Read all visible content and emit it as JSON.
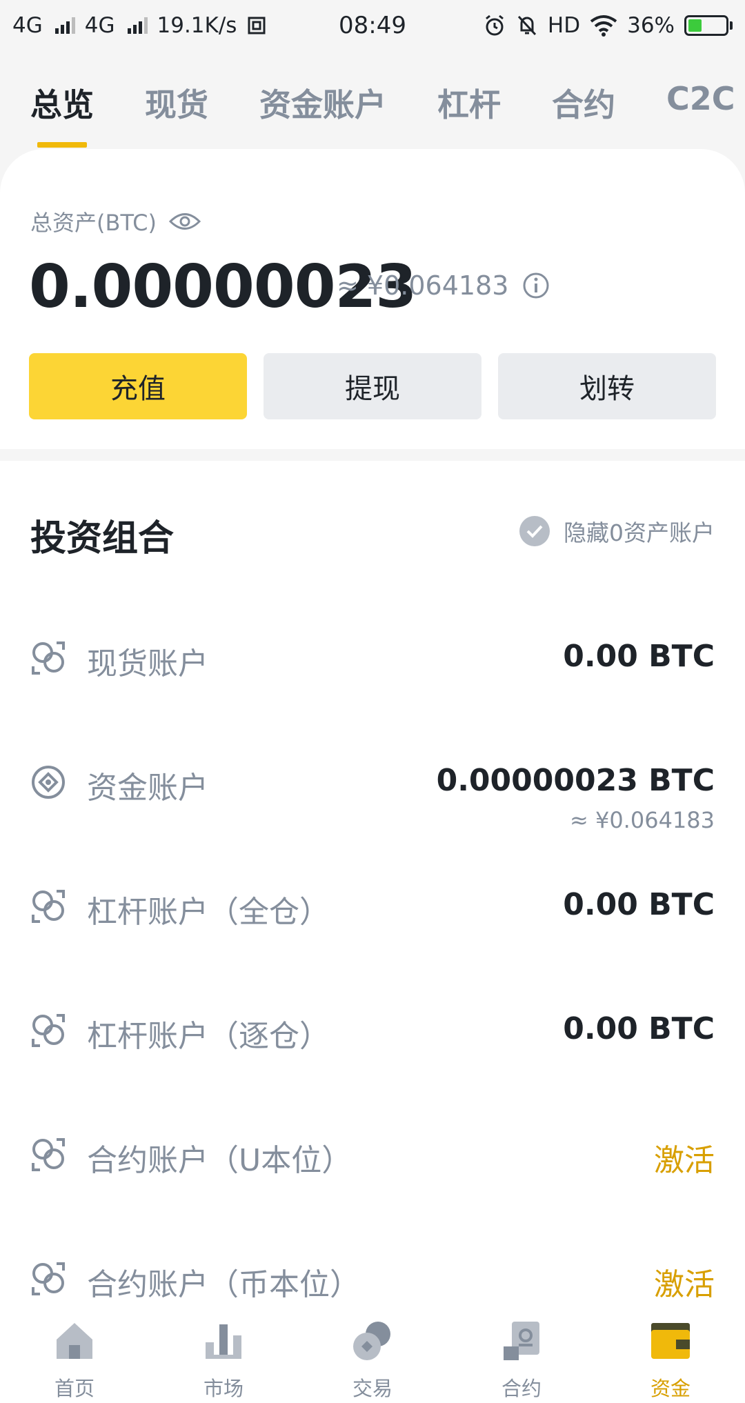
{
  "status_bar": {
    "network1": "4G",
    "network2": "4G",
    "speed": "19.1K/s",
    "time": "08:49",
    "hd": "HD",
    "battery": "36%",
    "battery_level": 0.36
  },
  "tabs": [
    {
      "label": "总览",
      "active": true
    },
    {
      "label": "现货",
      "active": false
    },
    {
      "label": "资金账户",
      "active": false
    },
    {
      "label": "杠杆",
      "active": false
    },
    {
      "label": "合约",
      "active": false
    },
    {
      "label": "C2C",
      "active": false
    }
  ],
  "summary": {
    "label": "总资产(BTC)",
    "total": "0.00000023",
    "approx": "≈ ¥0.064183",
    "buttons": {
      "deposit": "充值",
      "withdraw": "提现",
      "transfer": "划转"
    }
  },
  "portfolio": {
    "title": "投资组合",
    "hide_zero": "隐藏0资产账户",
    "accounts": [
      {
        "name": "现货账户",
        "value": "0.00 BTC"
      },
      {
        "name": "资金账户",
        "value": "0.00000023 BTC",
        "sub": "≈ ¥0.064183"
      },
      {
        "name": "杠杆账户（全仓）",
        "value": "0.00 BTC"
      },
      {
        "name": "杠杆账户（逐仓）",
        "value": "0.00 BTC"
      },
      {
        "name": "合约账户（U本位）",
        "action": "激活"
      },
      {
        "name": "合约账户（币本位）",
        "action": "激活"
      }
    ]
  },
  "bottom_nav": [
    {
      "label": "首页",
      "icon": "home-icon",
      "active": false
    },
    {
      "label": "市场",
      "icon": "market-icon",
      "active": false
    },
    {
      "label": "交易",
      "icon": "trade-icon",
      "active": false
    },
    {
      "label": "合约",
      "icon": "futures-icon",
      "active": false
    },
    {
      "label": "资金",
      "icon": "wallet-icon",
      "active": true
    }
  ],
  "colors": {
    "accent": "#FCD535",
    "activate": "#D89F00",
    "text_primary": "#1E2329",
    "text_secondary": "#848E9C"
  }
}
